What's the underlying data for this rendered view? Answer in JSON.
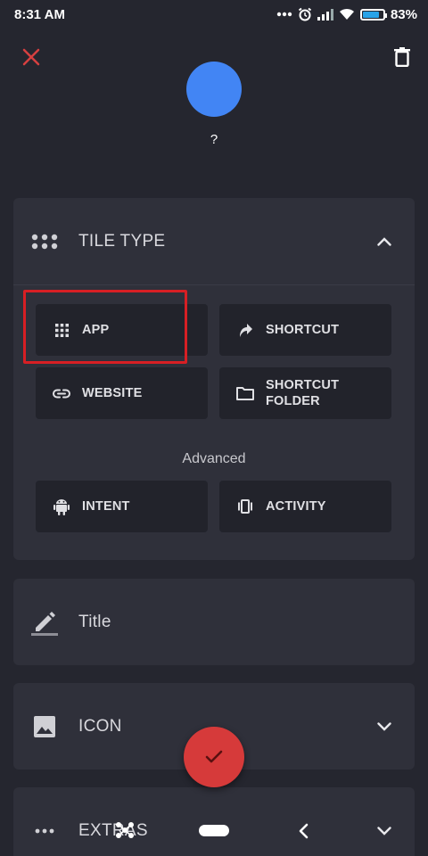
{
  "status_bar": {
    "time": "8:31 AM",
    "icons": [
      "more-dots-icon",
      "alarm-icon",
      "signal-icon",
      "wifi-icon",
      "battery-icon"
    ],
    "battery_percent": "83%",
    "battery_level": 0.83
  },
  "header": {
    "close_icon": "close-icon",
    "delete_icon": "trash-icon",
    "tile_name": "?",
    "avatar_color": "#4285f4"
  },
  "tile_type": {
    "label": "TILE TYPE",
    "options": [
      {
        "label": "APP",
        "icon": "apps-grid-icon"
      },
      {
        "label": "SHORTCUT",
        "icon": "shortcut-arrow-icon"
      },
      {
        "label": "WEBSITE",
        "icon": "link-icon"
      },
      {
        "label": "SHORTCUT\nFOLDER",
        "icon": "folder-icon"
      }
    ],
    "advanced_label": "Advanced",
    "advanced_options": [
      {
        "label": "INTENT",
        "icon": "android-icon"
      },
      {
        "label": "ACTIVITY",
        "icon": "activity-icon"
      }
    ]
  },
  "title_section": {
    "label": "Title"
  },
  "icon_section": {
    "label": "ICON"
  },
  "extras_section": {
    "label": "EXTRAS"
  },
  "colors": {
    "background": "#25262f",
    "card": "#2f303a",
    "button": "#22232b",
    "accent_red": "#d63a3a",
    "highlight": "#d71f24"
  }
}
